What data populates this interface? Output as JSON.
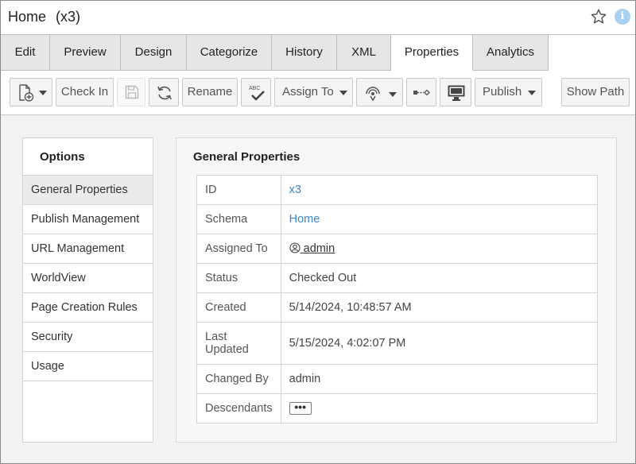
{
  "header": {
    "title": "Home",
    "subtitle": "(x3)",
    "star_icon": "star-outline-icon",
    "info_icon": "info-icon",
    "info_glyph": "i"
  },
  "tabs": [
    {
      "label": "Edit"
    },
    {
      "label": "Preview"
    },
    {
      "label": "Design"
    },
    {
      "label": "Categorize"
    },
    {
      "label": "History"
    },
    {
      "label": "XML"
    },
    {
      "label": "Properties",
      "active": true
    },
    {
      "label": "Analytics"
    }
  ],
  "toolbar": {
    "check_in": "Check In",
    "rename": "Rename",
    "spell_abc": "ABC",
    "assign_to": "Assign To",
    "publish": "Publish",
    "show_path": "Show Path"
  },
  "options": {
    "title": "Options",
    "items": [
      {
        "label": "General Properties",
        "active": true
      },
      {
        "label": "Publish Management"
      },
      {
        "label": "URL Management"
      },
      {
        "label": "WorldView"
      },
      {
        "label": "Page Creation Rules"
      },
      {
        "label": "Security"
      },
      {
        "label": "Usage"
      }
    ]
  },
  "general": {
    "title": "General Properties",
    "rows": {
      "id": {
        "key": "ID",
        "value": "x3"
      },
      "schema": {
        "key": "Schema",
        "value": "Home"
      },
      "assigned_to": {
        "key": "Assigned To",
        "value": "admin"
      },
      "status": {
        "key": "Status",
        "value": "Checked Out"
      },
      "created": {
        "key": "Created",
        "value": "5/14/2024, 10:48:57 AM"
      },
      "last_updated": {
        "key_line1": "Last",
        "key_line2": "Updated",
        "value": "5/15/2024, 4:02:07 PM"
      },
      "changed_by": {
        "key": "Changed By",
        "value": "admin"
      },
      "descendants": {
        "key": "Descendants",
        "value": "•••"
      }
    }
  },
  "colors": {
    "link": "#3a86c8",
    "active_tab": "#ffffff",
    "inactive_tab": "#e6e6e6",
    "info": "#a8d0f0"
  }
}
